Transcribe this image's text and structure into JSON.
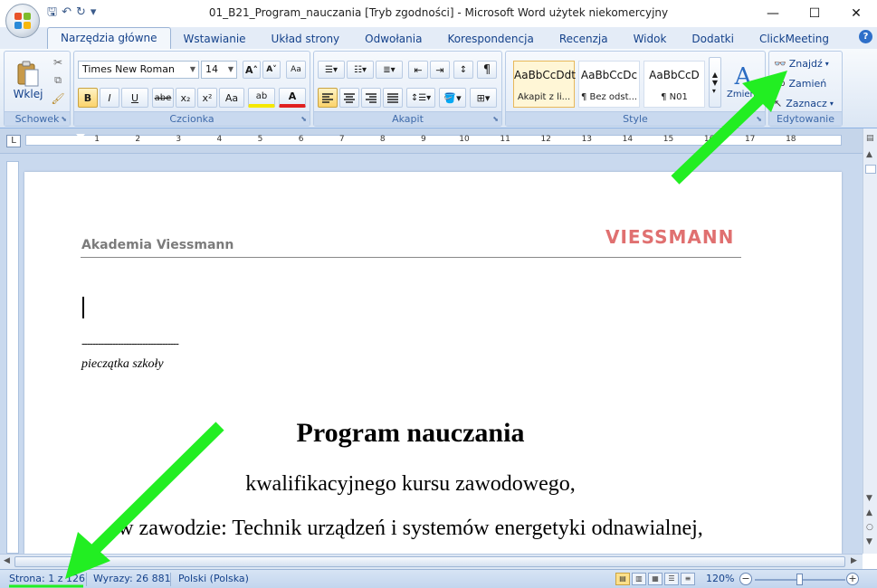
{
  "window": {
    "title": "01_B21_Program_nauczania [Tryb zgodności] - Microsoft Word użytek niekomercyjny",
    "minimize": "—",
    "maximize": "☐",
    "close": "✕"
  },
  "qat": {
    "save": "🖫",
    "undo": "↶",
    "redo": "↻",
    "customize": "▾"
  },
  "tabs": [
    {
      "label": "Narzędzia główne",
      "active": true
    },
    {
      "label": "Wstawianie"
    },
    {
      "label": "Układ strony"
    },
    {
      "label": "Odwołania"
    },
    {
      "label": "Korespondencja"
    },
    {
      "label": "Recenzja"
    },
    {
      "label": "Widok"
    },
    {
      "label": "Dodatki"
    },
    {
      "label": "ClickMeeting"
    }
  ],
  "help": "?",
  "ribbon": {
    "clipboard": {
      "label": "Schowek",
      "paste": "Wklej"
    },
    "font": {
      "label": "Czcionka",
      "family": "Times New Roman",
      "size": "14",
      "grow": "A˄",
      "shrink": "A˅",
      "clear": "Aa",
      "bold": "B",
      "italic": "I",
      "underline": "U",
      "strike": "abe",
      "subscript": "x₂",
      "superscript": "x²",
      "case": "Aa",
      "highlight": "ab",
      "color": "A"
    },
    "paragraph": {
      "label": "Akapit",
      "show_marks": "¶"
    },
    "styles": {
      "label": "Style",
      "items": [
        {
          "sample": "AaBbCcDdt",
          "name": "Akapit z li..."
        },
        {
          "sample": "AaBbCcDc",
          "name": "¶ Bez odst..."
        },
        {
          "sample": "AaBbCcD",
          "name": "¶ N01"
        }
      ],
      "change": "Zmień style"
    },
    "editing": {
      "label": "Edytowanie",
      "find": "Znajdź",
      "replace": "Zamień",
      "select": "Zaznacz"
    }
  },
  "ruler": {
    "tab_selector": "L",
    "numbers": [
      "1",
      "2",
      "3",
      "4",
      "5",
      "6",
      "7",
      "8",
      "9",
      "10",
      "11",
      "12",
      "13",
      "14",
      "15",
      "16",
      "17",
      "18"
    ]
  },
  "document": {
    "header_org": "Akademia Viessmann",
    "brand": "VIESSMANN",
    "dashes": "-----------------------------------",
    "stamp_label": "pieczątka szkoły",
    "title": "Program nauczania",
    "line1": "kwalifikacyjnego kursu zawodowego,",
    "line2": "w zawodzie: Technik urządzeń i systemów energetyki odnawialnej,"
  },
  "status": {
    "page": "Strona: 1 z 126",
    "words": "Wyrazy: 26 881",
    "language": "Polski (Polska)",
    "zoom": "120%",
    "zoom_out": "−",
    "zoom_in": "+"
  },
  "colors": {
    "accent": "#15428b",
    "ribbon_bg": "#dbe6f4",
    "annotation_arrow": "#22ee22",
    "brand_logo": "#e07070"
  }
}
